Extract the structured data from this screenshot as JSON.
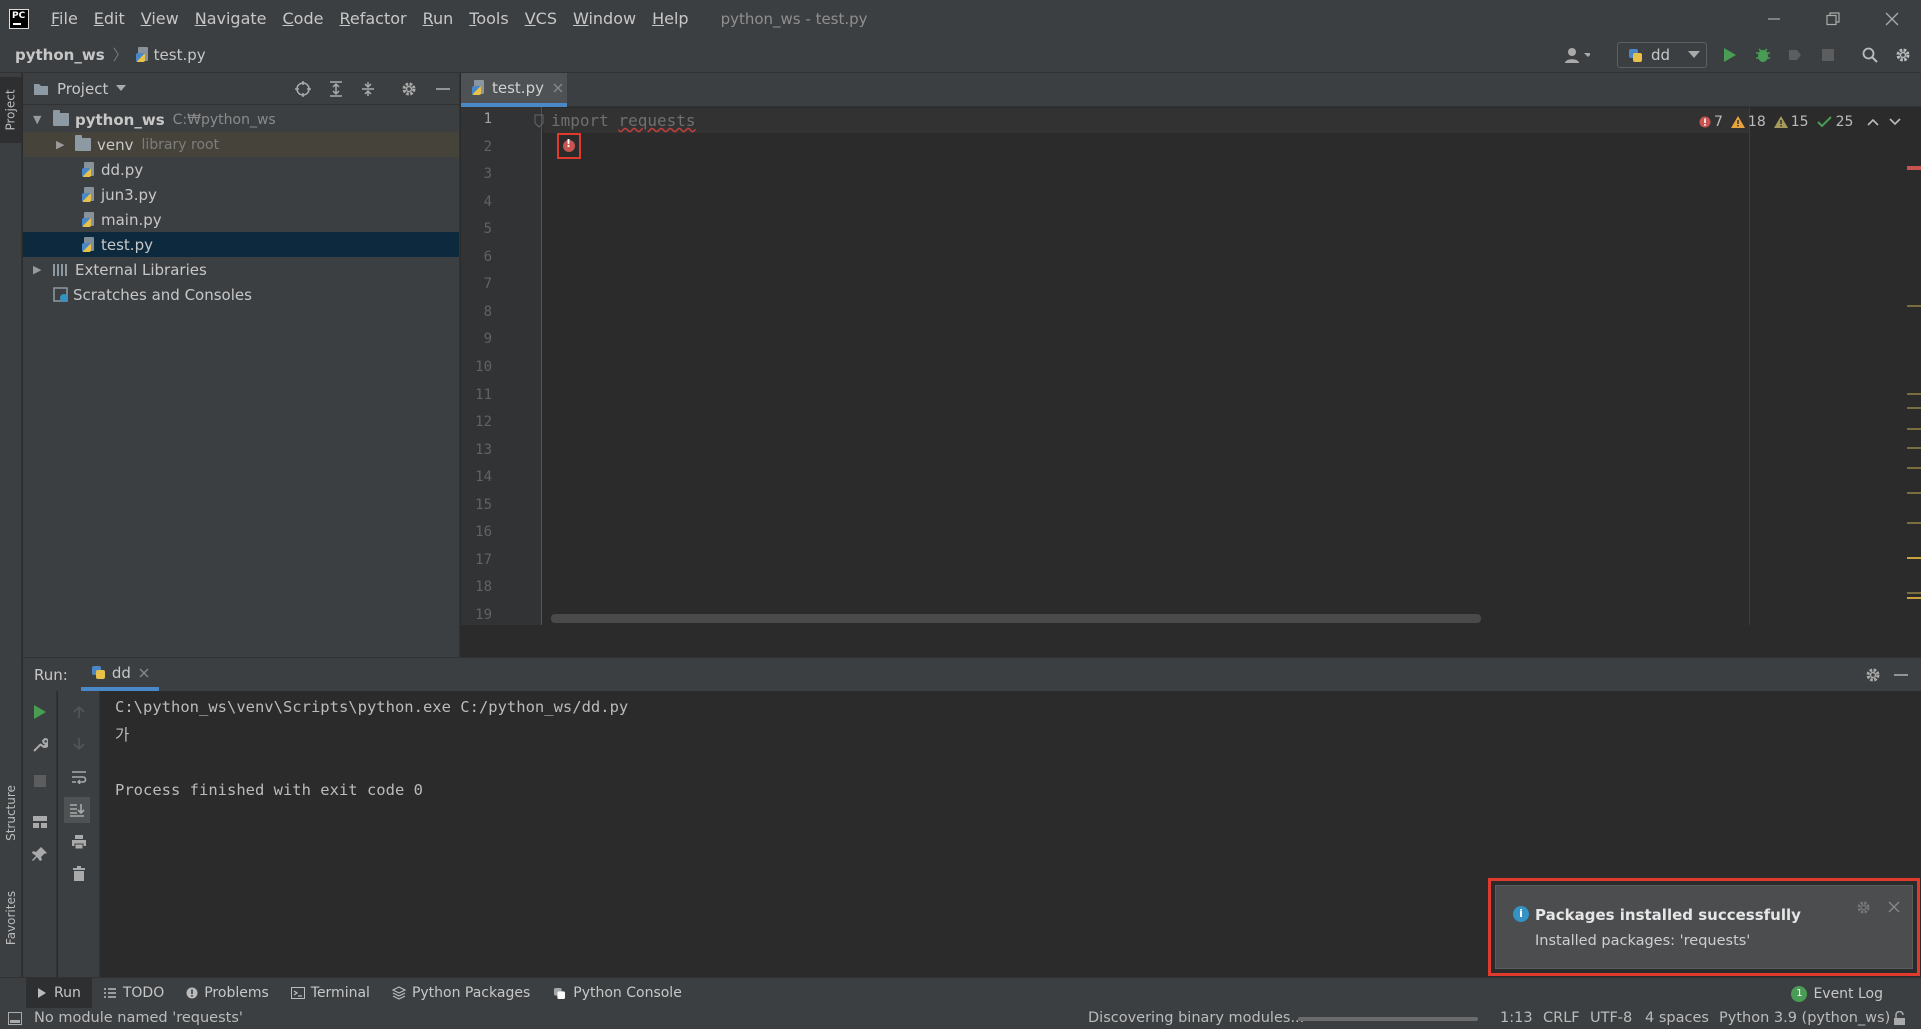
{
  "menu": {
    "items": [
      "File",
      "Edit",
      "View",
      "Navigate",
      "Code",
      "Refactor",
      "Run",
      "Tools",
      "VCS",
      "Window",
      "Help"
    ],
    "window_title": "python_ws - test.py"
  },
  "nav": {
    "project": "python_ws",
    "file": "test.py"
  },
  "toolbar": {
    "run_config": "dd"
  },
  "project_panel": {
    "title": "Project",
    "root_name": "python_ws",
    "root_path": "C:₩python_ws",
    "venv": "venv",
    "venv_hint": "library root",
    "files": [
      "dd.py",
      "jun3.py",
      "main.py",
      "test.py"
    ],
    "external": "External Libraries",
    "scratches": "Scratches and Consoles"
  },
  "left_stripe": {
    "project": "Project",
    "structure": "Structure",
    "favorites": "Favorites"
  },
  "editor": {
    "tab": "test.py",
    "line_numbers": [
      "1",
      "2",
      "3",
      "4",
      "5",
      "6",
      "7",
      "8",
      "9",
      "10",
      "11",
      "12",
      "13",
      "14",
      "15",
      "16",
      "17",
      "18",
      "19"
    ],
    "code_kw": "import",
    "code_mod": "requests",
    "inspections": {
      "errors": "7",
      "warnings": "18",
      "weak_warnings": "15",
      "ok": "25"
    }
  },
  "run_panel": {
    "label": "Run:",
    "tab": "dd",
    "console": [
      "C:\\python_ws\\venv\\Scripts\\python.exe C:/python_ws/dd.py",
      "가",
      "",
      "Process finished with exit code 0"
    ]
  },
  "notification": {
    "title": "Packages installed successfully",
    "text": "Installed packages: 'requests'"
  },
  "bottom_tools": [
    "Run",
    "TODO",
    "Problems",
    "Terminal",
    "Python Packages",
    "Python Console"
  ],
  "event_log": {
    "label": "Event Log",
    "count": "1"
  },
  "status": {
    "message": "No module named 'requests'",
    "progress_text": "Discovering binary modules...",
    "position": "1:13",
    "line_sep": "CRLF",
    "encoding": "UTF-8",
    "indent": "4 spaces",
    "interpreter": "Python 3.9 (python_ws)"
  },
  "colors": {
    "accent": "#4a88c7",
    "error": "#e03a2f",
    "run_green": "#499c54"
  }
}
